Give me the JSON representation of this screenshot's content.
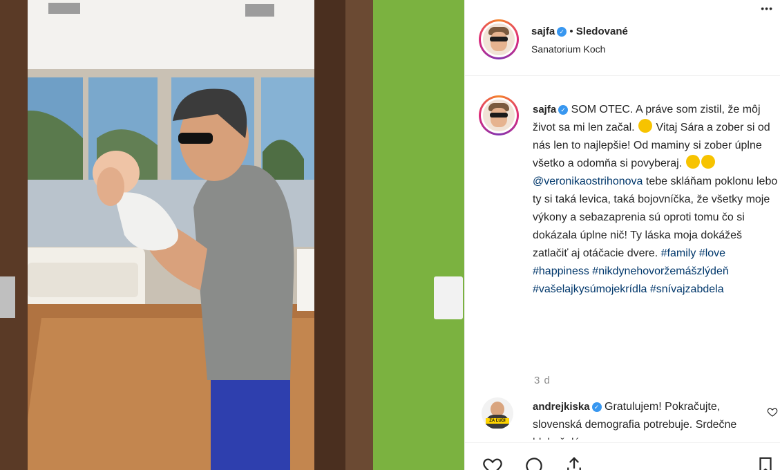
{
  "post": {
    "username": "sajfa",
    "follow_sep": " • ",
    "follow_status": "Sledované",
    "location": "Sanatorium Koch",
    "more_icon": "more-horizontal-icon",
    "caption_user": "sajfa",
    "caption_text_1": " SOM OTEC. A práve som zistil, že môj život sa mi len začal. ",
    "caption_text_2": " Vitaj Sára a zober si od nás len to najlepšie! Od maminy si zober úplne všetko a odomňa si povyberaj. ",
    "caption_mention": "@veronikaostrihonova",
    "caption_text_3": " tebe skláňam poklonu lebo ty si taká levica, taká bojovníčka, že všetky moje výkony a sebazaprenia sú oproti tomu čo si dokázala úplne nič! Ty láska moja dokážeš zatlačiť aj otáčacie dvere.",
    "hashtags": [
      "#family",
      "#love",
      "#happiness",
      "#nikdynehovoržemášzlýdeň",
      "#vašelajkysúmojekrídla",
      "#snívajzabdela"
    ],
    "time": "3 d"
  },
  "comment": {
    "username": "andrejkiska",
    "text": " Gratulujem! Pokračujte, slovenská demografia potrebuje. Srdečne blahoželám.",
    "badge": "ZA ĽUDÍ"
  },
  "colors": {
    "verified": "#3897f0",
    "link": "#00376b",
    "text": "#262626",
    "muted": "#8e8e8e"
  }
}
